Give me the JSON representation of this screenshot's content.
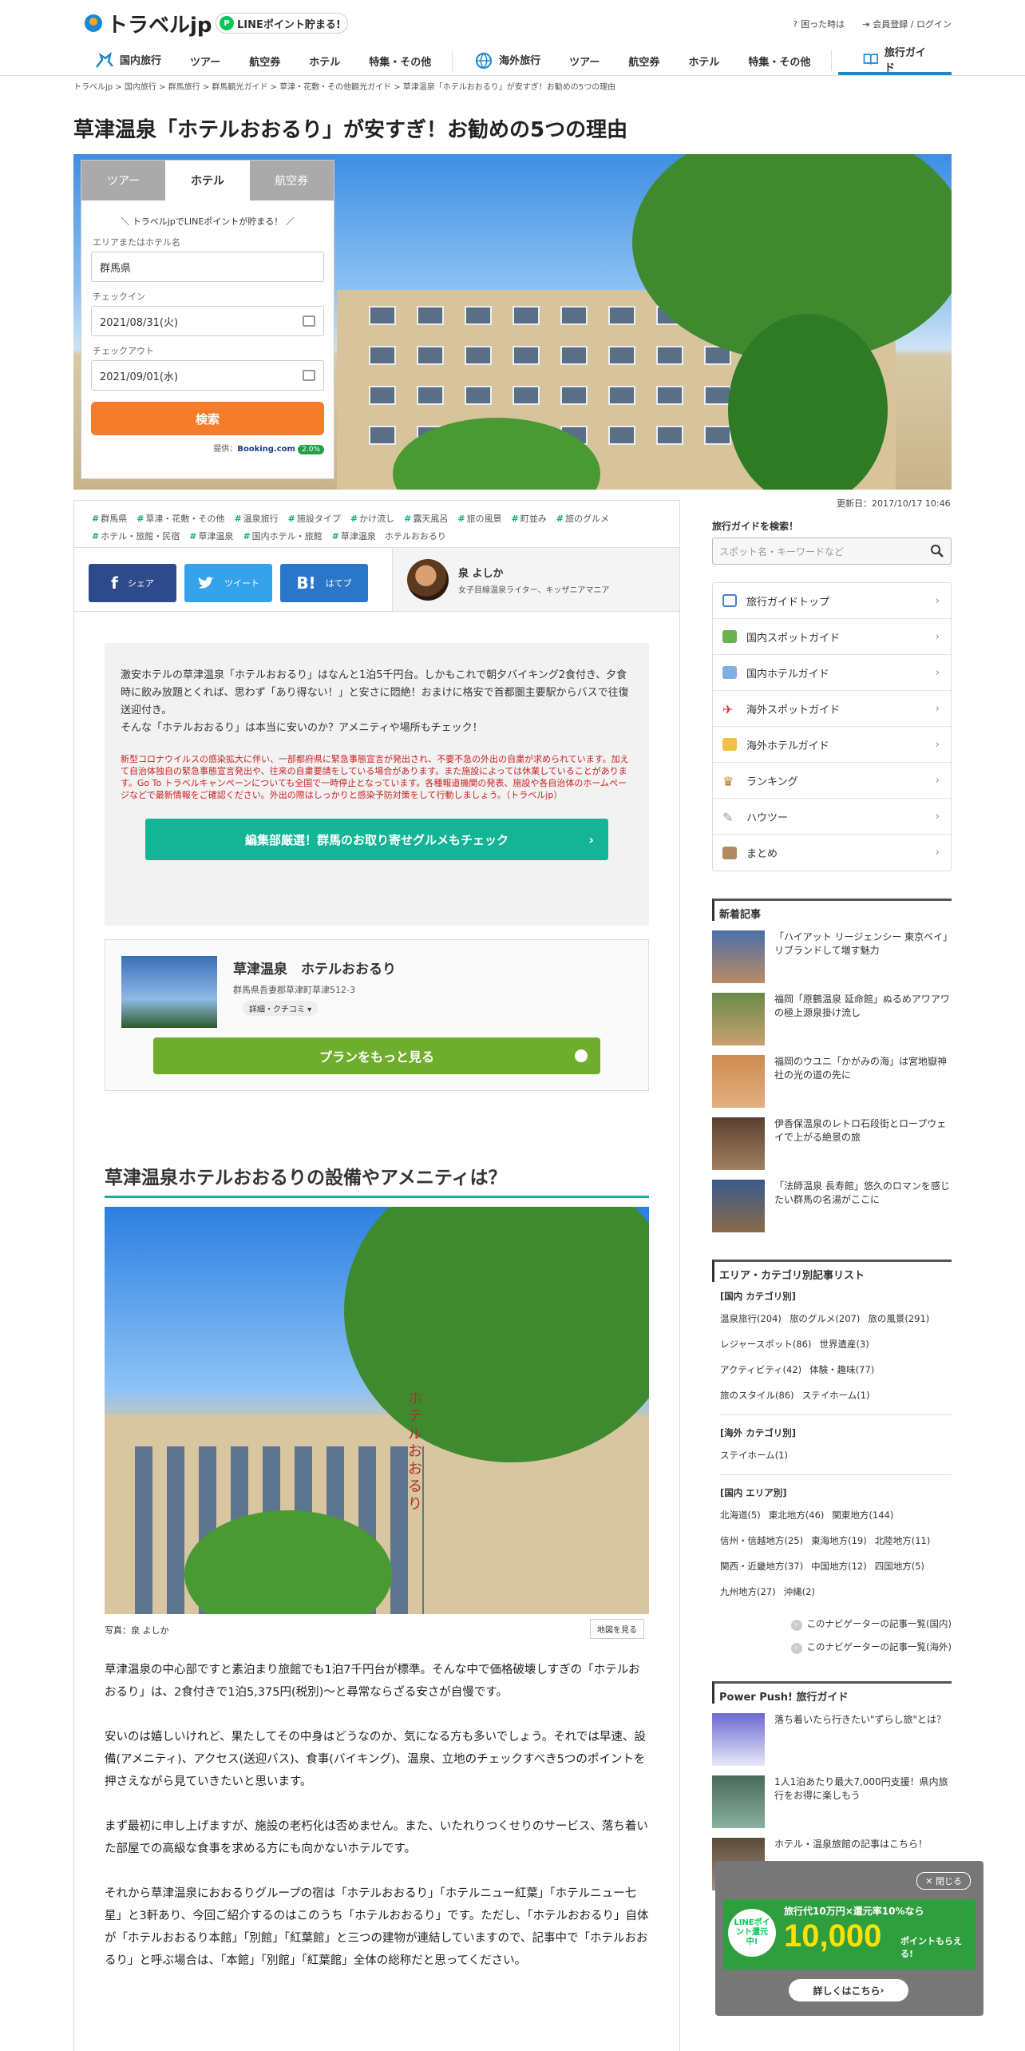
{
  "header": {
    "logo": "トラベルjp",
    "line": "LINEポイント貯まる!",
    "links": [
      "困った時は",
      "会員登録 / ログイン"
    ]
  },
  "nav": {
    "domestic": [
      "国内旅行",
      "ツアー",
      "航空券",
      "ホテル",
      "特集・その他"
    ],
    "overseas": [
      "海外旅行",
      "ツアー",
      "航空券",
      "ホテル",
      "特集・その他"
    ],
    "guide": "旅行ガイド"
  },
  "breadcrumb": "トラベルjp  >  国内旅行  >  群馬旅行  >  群馬観光ガイド  >  草津・花敷・その他観光ガイド  >  草津温泉「ホテルおおるり」が安すぎ！お勧めの5つの理由",
  "title": "草津温泉「ホテルおおるり」が安すぎ！お勧めの5つの理由",
  "search": {
    "tabs": [
      "ツアー",
      "ホテル",
      "航空券"
    ],
    "note": "＼ トラベルjpでLINEポイントが貯まる！ ／",
    "area_label": "エリアまたはホテル名",
    "area_value": "群馬県",
    "checkin_label": "チェックイン",
    "checkin": "2021/08/31(火)",
    "checkout_label": "チェックアウト",
    "checkout": "2021/09/01(水)",
    "button": "検索",
    "provider": "提供：",
    "provider_brand": "Booking.com",
    "rate": "2.0%"
  },
  "updated": "更新日：2017/10/17 10:46",
  "tags": [
    "群馬県",
    "草津・花敷・その他",
    "温泉旅行",
    "施設タイプ",
    "かけ流し",
    "露天風呂",
    "旅の風景",
    "町並み",
    "旅のグルメ",
    "ホテル・旅館・民宿",
    "草津温泉",
    "国内ホテル・旅館",
    "草津温泉　ホテルおおるり"
  ],
  "share": {
    "facebook": "シェア",
    "twitter": "ツイート",
    "hatena": "はてブ"
  },
  "author": {
    "name": "泉 よしか",
    "desc": "女子目線温泉ライター、キッザニアマニア"
  },
  "intro": {
    "p1": "激安ホテルの草津温泉「ホテルおおるり」はなんと1泊5千円台。しかもこれで朝夕バイキング2食付き、夕食時に飲み放題とくれば、思わず「あり得ない！」と安さに悶絶！おまけに格安で首都圏主要駅からバスで往復送迎付き。",
    "p2": "そんな「ホテルおおるり」は本当に安いのか？アメニティや場所もチェック！",
    "covid": "新型コロナウイルスの感染拡大に伴い、一部都府県に緊急事態宣言が発出され、不要不急の外出の自粛が求められています。加えて自治体独自の緊急事態宣言発出や、往来の自粛要請をしている場合があります。また施設によっては休業していることがあります。Go To トラベルキャンペーンについても全国で一時停止となっています。各種報道機関の発表、施設や各自治体のホームページなどで最新情報をご確認ください。外出の際はしっかりと感染予防対策をして行動しましょう。（トラベルjp）",
    "button": "編集部厳選！群馬のお取り寄せグルメもチェック"
  },
  "hotel": {
    "name": "草津温泉　ホテルおおるり",
    "address": "群馬県吾妻郡草津町草津512-3",
    "detail": "詳細・クチコミ",
    "plan": "プランをもっと見る"
  },
  "section": {
    "h2": "草津温泉ホテルおおるりの設備やアメニティは？",
    "caption": "写真：泉 よしか",
    "map": "地図を見る",
    "sign": "ホテルおおるり"
  },
  "body": [
    "草津温泉の中心部ですと素泊まり旅館でも1泊7千円台が標準。そんな中で価格破壊しすぎの「ホテルおおるり」は、2食付きで1泊5,375円(税別)～と尋常ならざる安さが自慢です。",
    "安いのは嬉しいけれど、果たしてその中身はどうなのか、気になる方も多いでしょう。それでは早速、設備(アメニティ)、アクセス(送迎バス)、食事(バイキング)、温泉、立地のチェックすべき5つのポイントを押さえながら見ていきたいと思います。",
    "まず最初に申し上げますが、施設の老朽化は否めません。また、いたれりつくせりのサービス、落ち着いた部屋での高級な食事を求める方にも向かないホテルです。",
    "それから草津温泉におおるりグループの宿は「ホテルおおるり」「ホテルニュー紅葉」「ホテルニュー七星」と3軒あり、今回ご紹介するのはこのうち「ホテルおおるり」です。ただし、「ホテルおおるり」自体が「ホテルおおるり本館」「別館」「紅葉館」と三つの建物が連結していますので、記事中で「ホテルおおるり」と呼ぶ場合は、「本館」「別館」「紅葉館」全体の総称だと思ってください。"
  ],
  "sidebar": {
    "search_label": "旅行ガイドを検索！",
    "search_placeholder": "スポット名・キーワードなど",
    "menu": [
      "旅行ガイドトップ",
      "国内スポットガイド",
      "国内ホテルガイド",
      "海外スポットガイド",
      "海外ホテルガイド",
      "ランキング",
      "ハウツー",
      "まとめ"
    ],
    "new_heading": "新着記事",
    "news": [
      "「ハイアット リージェンシー 東京ベイ」リブランドして増す魅力",
      "福岡「原鶴温泉 延命館」ぬるめアワアワの極上源泉掛け流し",
      "福岡のウユニ「かがみの海」は宮地嶽神社の光の道の先に",
      "伊香保温泉のレトロ石段街とロープウェイで上がる絶景の旅",
      "「法師温泉 長寿館」悠久のロマンを感じたい群馬の名湯がここに"
    ],
    "cat_heading": "エリア・カテゴリ別記事リスト",
    "dom_cat": "[国内 カテゴリ別]",
    "dom_cats": [
      "温泉旅行(204)",
      "旅のグルメ(207)",
      "旅の風景(291)",
      "レジャースポット(86)",
      "世界遺産(3)",
      "アクティビティ(42)",
      "体験・趣味(77)",
      "旅のスタイル(86)",
      "ステイホーム(1)"
    ],
    "ovs_cat": "[海外 カテゴリ別]",
    "ovs_cats": [
      "ステイホーム(1)"
    ],
    "dom_area": "[国内 エリア別]",
    "dom_areas": [
      "北海道(5)",
      "東北地方(46)",
      "関東地方(144)",
      "信州・信越地方(25)",
      "東海地方(19)",
      "北陸地方(11)",
      "関西・近畿地方(37)",
      "中国地方(12)",
      "四国地方(5)",
      "九州地方(27)",
      "沖縄(2)"
    ],
    "link1": "このナビゲーターの記事一覧(国内)",
    "link2": "このナビゲーターの記事一覧(海外)",
    "pp_heading": "Power Push! 旅行ガイド",
    "pp": [
      "落ち着いたら行きたい\"ずらし旅\"とは？",
      "1人1泊あたり最大7,000円支援！県内旅行をお得に楽しもう",
      "ホテル・温泉旅館の記事はこちら！"
    ]
  },
  "overlay": {
    "close": "閉じる",
    "banner_line": "LINEポイント還元中!",
    "banner_text": "旅行代10万円×還元率10%なら",
    "banner_points": "10,000",
    "banner_unit": "ポイントもらえる!",
    "button": "詳しくはこちら"
  }
}
